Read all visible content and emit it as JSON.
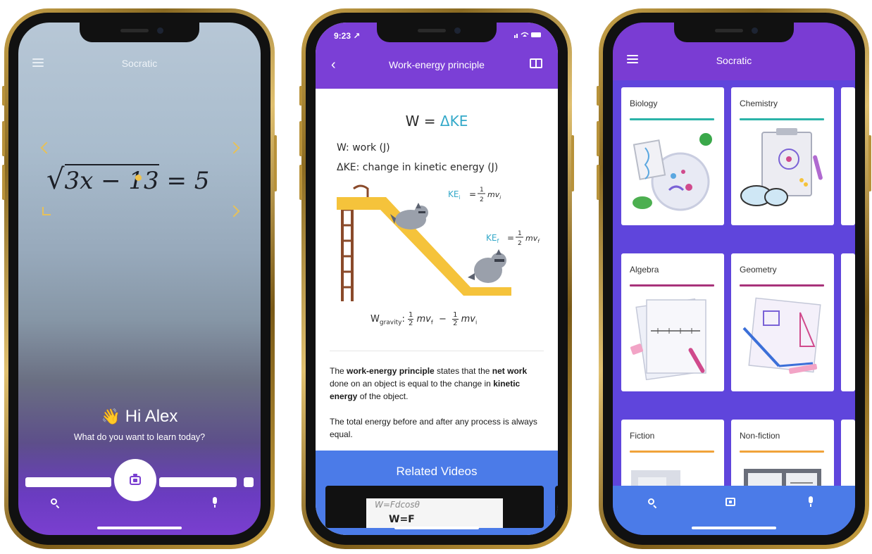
{
  "phone_camera": {
    "app_title": "Socratic",
    "equation_radicand": "3x − 13",
    "equation_rhs": "= 5",
    "greeting_emoji": "👋",
    "greeting_text": "Hi Alex",
    "prompt_text": "What do you want to learn today?",
    "icons": [
      "menu-icon",
      "camera-icon",
      "search-icon",
      "microphone-icon"
    ]
  },
  "phone_explainer": {
    "status_time": "9:23",
    "status_time_arrow": "↗",
    "header_title": "Work-energy principle",
    "formula_main_left": "W = ",
    "formula_main_right": "ΔKE",
    "definition_work": "W: work (J)",
    "definition_ke": "ΔKE: change in kinetic energy (J)",
    "ke_initial_label": "KE",
    "ke_initial_sub": "i",
    "ke_final_label": "KE",
    "ke_final_sub": "f",
    "ke_equals": "=",
    "frac_num": "1",
    "frac_den": "2",
    "mv_text": "mv",
    "w_gravity": "W",
    "w_gravity_sub": "gravity",
    "para1_prefix": "The ",
    "para1_bold1": "work-energy principle",
    "para1_mid1": " states that the ",
    "para1_bold2": "net work",
    "para1_mid2": " done on an object is equal to the change in ",
    "para1_bold3": "kinetic energy",
    "para1_suffix": " of the object.",
    "para2": "The total energy before and after any process is always equal.",
    "related_title": "Related Videos",
    "video_scribble": "W=Fdcosθ",
    "video_scribble2": "W=F"
  },
  "phone_subjects": {
    "app_title": "Socratic",
    "cards": [
      {
        "label": "Biology",
        "accent": "#2bb3a8"
      },
      {
        "label": "Chemistry",
        "accent": "#2bb3a8"
      },
      {
        "label": "Algebra",
        "accent": "#a8337a"
      },
      {
        "label": "Geometry",
        "accent": "#a8337a"
      },
      {
        "label": "Fiction",
        "accent": "#f0a33a"
      },
      {
        "label": "Non-fiction",
        "accent": "#f0a33a"
      }
    ],
    "nav_icons": [
      "search-icon",
      "camera-icon",
      "microphone-icon"
    ]
  },
  "colors": {
    "purple": "#7b3fd6",
    "blue": "#4b7be8",
    "teal": "#34a9c9",
    "gold_frame": "#c9a44c",
    "focus_yellow": "#f0c24a"
  }
}
